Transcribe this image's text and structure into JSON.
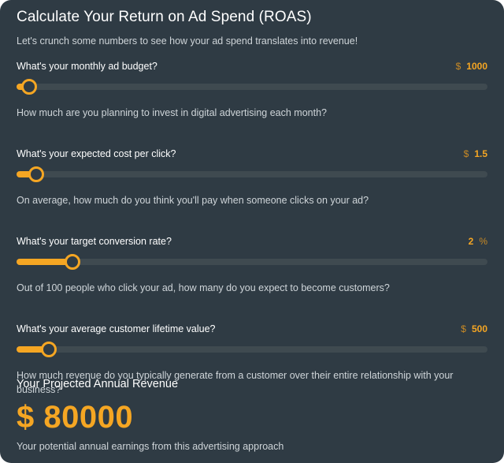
{
  "calculator": {
    "title": "Calculate Your Return on Ad Spend (ROAS)",
    "subtitle": "Let's crunch some numbers to see how your ad spend translates into revenue!",
    "fields": [
      {
        "label": "What's your monthly ad budget?",
        "unit_before": "$",
        "value": "1000",
        "unit_after": "",
        "slider_fraction": 0.02,
        "helper": "How much are you planning to invest in digital advertising each month?"
      },
      {
        "label": "What's your expected cost per click?",
        "unit_before": "$",
        "value": "1.5",
        "unit_after": "",
        "slider_fraction": 0.035,
        "helper": "On average, how much do you think you'll pay when someone clicks on your ad?"
      },
      {
        "label": "What's your target conversion rate?",
        "unit_before": "",
        "value": "2",
        "unit_after": "%",
        "slider_fraction": 0.112,
        "helper": "Out of 100 people who click your ad, how many do you expect to become customers?"
      },
      {
        "label": "What's your average customer lifetime value?",
        "unit_before": "$",
        "value": "500",
        "unit_after": "",
        "slider_fraction": 0.062,
        "helper": "How much revenue do you typically generate from a customer over their entire relationship with your business?"
      }
    ]
  },
  "result": {
    "title": "Your Projected Annual Revenue",
    "amount": "$ 80000",
    "note": "Your potential annual earnings from this advertising approach"
  },
  "colors": {
    "background": "#2f3b44",
    "accent": "#f5a623",
    "track": "#3f4a50"
  }
}
